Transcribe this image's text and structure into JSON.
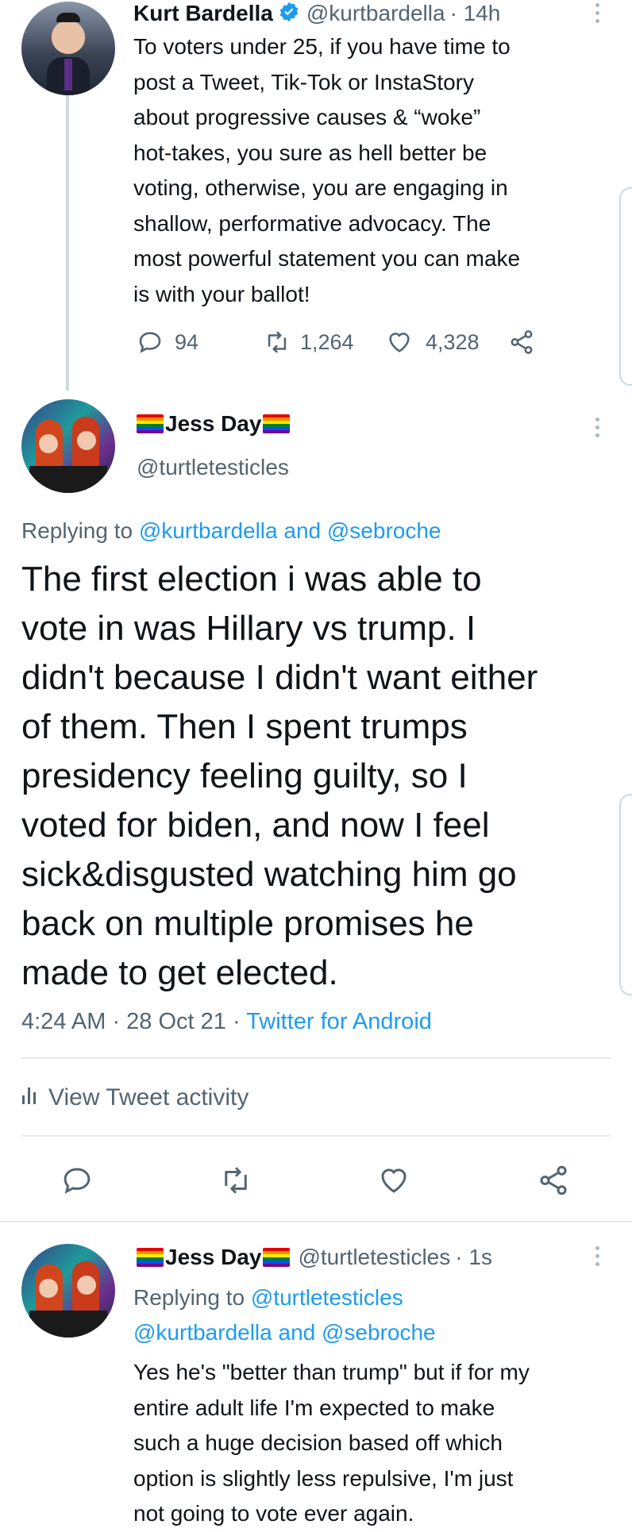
{
  "tweet1": {
    "name": "Kurt Bardella",
    "handle": "@kurtbardella",
    "time": "· 14h",
    "text_lines": [
      "To voters under 25, if you have time to",
      "post a Tweet, Tik-Tok or InstaStory",
      "about progressive causes & “woke”",
      "hot-takes, you sure as hell better be",
      "voting, otherwise, you are engaging in",
      "shallow, performative advocacy. The",
      "most powerful statement you can make",
      "is with your ballot!"
    ],
    "replies": "94",
    "retweets": "1,264",
    "likes": "4,328"
  },
  "main_tweet": {
    "name": "Jess Day",
    "handle": "@turtletesticles",
    "replying_prefix": "Replying to ",
    "replying_users": "@kurtbardella and @sebroche",
    "text_lines": [
      "The first election i was able to",
      "vote in was Hillary vs trump. I",
      "didn't because I didn't want either",
      "of them. Then I spent trumps",
      "presidency feeling guilty, so I",
      "voted for biden, and now I feel",
      "sick&disgusted watching him go",
      "back on multiple promises he",
      "made to get elected."
    ],
    "timestamp": "4:24 AM · 28 Oct 21 · ",
    "source": "Twitter for Android",
    "activity_label": "View Tweet activity"
  },
  "reply": {
    "name": "Jess Day",
    "handle": "@turtletesticles",
    "time": "· 1s",
    "replying_prefix": "Replying to ",
    "replying_line1": "@turtletesticles",
    "replying_line2": "@kurtbardella and @sebroche",
    "text_lines": [
      "Yes he's \"better than trump\" but if for my",
      "entire adult life I'm expected to make",
      "such a huge decision based off which",
      "option is slightly less repulsive, I'm just",
      "not going to vote ever again."
    ]
  },
  "colors": {
    "accent": "#1d9bf0",
    "verified": "#1d9bf0",
    "muted": "#536471",
    "divider": "#e6ecf0"
  },
  "icons": [
    "reply-icon",
    "retweet-icon",
    "like-icon",
    "share-icon",
    "verified-badge-icon",
    "more-icon",
    "analytics-icon",
    "rainbow-flag-icon"
  ]
}
